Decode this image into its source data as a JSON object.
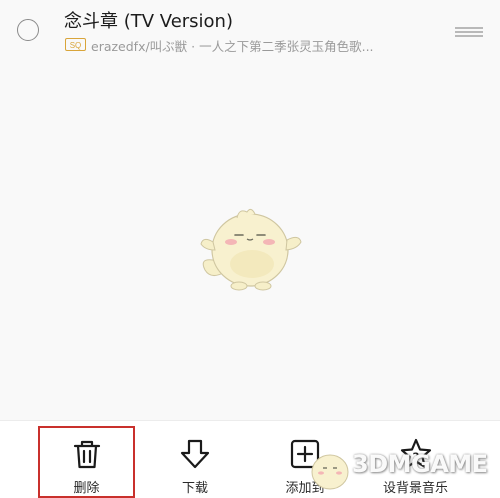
{
  "song": {
    "title": "念斗章 (TV Version)",
    "quality_badge": "SQ",
    "meta": "erazedfx/叫ぶ獣 · 一人之下第二季张灵玉角色歌..."
  },
  "toolbar": {
    "delete_label": "删除",
    "download_label": "下载",
    "add_to_label": "添加到",
    "set_ringtone_label": "设背景音乐"
  },
  "watermark": {
    "text": "3DMGAME"
  },
  "colors": {
    "highlight": "#c9302c",
    "sq_badge": "#d9a53a",
    "background": "#f9f9f9"
  }
}
